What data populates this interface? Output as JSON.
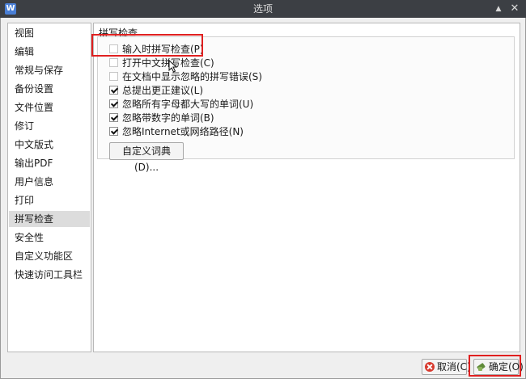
{
  "window": {
    "title": "选项",
    "app_icon_letter": "W",
    "collapse_glyph": "▲",
    "close_glyph": "✕"
  },
  "sidebar": {
    "items": [
      {
        "label": "视图"
      },
      {
        "label": "编辑"
      },
      {
        "label": "常规与保存"
      },
      {
        "label": "备份设置"
      },
      {
        "label": "文件位置"
      },
      {
        "label": "修订"
      },
      {
        "label": "中文版式"
      },
      {
        "label": "输出PDF"
      },
      {
        "label": "用户信息"
      },
      {
        "label": "打印"
      },
      {
        "label": "拼写检查",
        "selected": true
      },
      {
        "label": "安全性"
      },
      {
        "label": "自定义功能区"
      },
      {
        "label": "快速访问工具栏"
      }
    ]
  },
  "spellcheck": {
    "section_title": "拼写检查",
    "options": [
      {
        "label": "输入时拼写检查(P)",
        "checked": false
      },
      {
        "label": "打开中文拼写检查(C)",
        "checked": false
      },
      {
        "label": "在文档中显示忽略的拼写错误(S)",
        "checked": false
      },
      {
        "label": "总提出更正建议(L)",
        "checked": true
      },
      {
        "label": "忽略所有字母都大写的单词(U)",
        "checked": true
      },
      {
        "label": "忽略带数字的单词(B)",
        "checked": true
      },
      {
        "label": "忽略Internet或网络路径(N)",
        "checked": true
      }
    ],
    "custom_dict_button": "自定义词典(D)..."
  },
  "footer": {
    "cancel_label": "取消(C)",
    "ok_label": "确定(O)"
  },
  "colors": {
    "highlight": "#e02020",
    "titlebar": "#3c3f44",
    "selected_item": "#dcdcdc"
  }
}
